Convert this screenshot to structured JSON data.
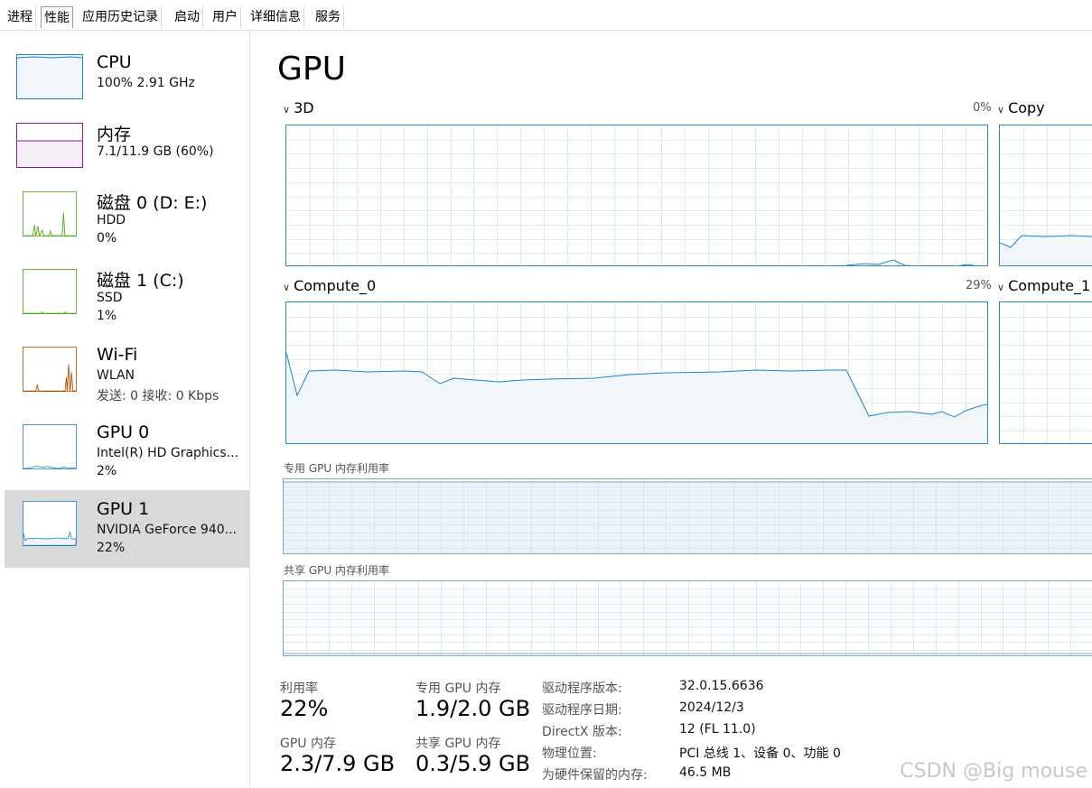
{
  "tabs": [
    "进程",
    "性能",
    "应用历史记录",
    "启动",
    "用户",
    "详细信息",
    "服务"
  ],
  "active_tab": "性能",
  "sidebar": [
    {
      "title": "CPU",
      "line1": "100% 2.91 GHz",
      "line2": ""
    },
    {
      "title": "内存",
      "line1": "7.1/11.9 GB (60%)",
      "line2": ""
    },
    {
      "title": "磁盘 0 (D: E:)",
      "line1": "HDD",
      "line2": "0%"
    },
    {
      "title": "磁盘 1 (C:)",
      "line1": "SSD",
      "line2": "1%"
    },
    {
      "title": "Wi-Fi",
      "line1": "WLAN",
      "line2": "发送: 0 接收: 0 Kbps"
    },
    {
      "title": "GPU 0",
      "line1": "Intel(R) HD Graphics...",
      "line2": "2%"
    },
    {
      "title": "GPU 1",
      "line1": "NVIDIA GeForce 940...",
      "line2": "22%"
    }
  ],
  "colors": {
    "cpu": "#1c86c7",
    "memory": "#8b12ae",
    "disk": "#4da60c",
    "wifi": "#a74f01",
    "gpu": "#1c86c7",
    "grid": "#d9eaf4",
    "fill": "#f1f6fa",
    "selected": "#d9d9d9"
  },
  "main": {
    "title": "GPU",
    "engines": [
      {
        "label": "3D",
        "percent": "0%"
      },
      {
        "label": "Copy",
        "percent": ""
      },
      {
        "label": "Compute_0",
        "percent": "29%"
      },
      {
        "label": "Compute_1",
        "percent": ""
      }
    ],
    "dedicated_label": "专用 GPU 内存利用率",
    "shared_label": "共享 GPU 内存利用率"
  },
  "stats": {
    "utilization_label": "利用率",
    "utilization": "22%",
    "dedicated_label": "专用 GPU 内存",
    "dedicated": "1.9/2.0 GB",
    "gpu_mem_label": "GPU 内存",
    "gpu_mem": "2.3/7.9 GB",
    "shared_label": "共享 GPU 内存",
    "shared": "0.3/5.9 GB"
  },
  "info": [
    {
      "key": "驱动程序版本:",
      "value": "32.0.15.6636"
    },
    {
      "key": "驱动程序日期:",
      "value": "2024/12/3"
    },
    {
      "key": "DirectX 版本:",
      "value": "12 (FL 11.0)"
    },
    {
      "key": "物理位置:",
      "value": "PCI 总线 1、设备 0、功能 0"
    },
    {
      "key": "为硬件保留的内存:",
      "value": "46.5 MB"
    }
  ],
  "watermark": "CSDN @Big mouse"
}
